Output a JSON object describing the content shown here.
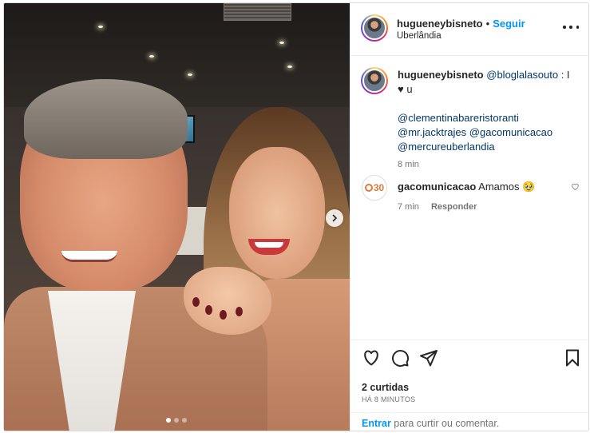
{
  "post": {
    "author": {
      "username": "hugueneybisneto",
      "location": "Uberlândia"
    },
    "follow_label": "Seguir",
    "separator": "•"
  },
  "caption": {
    "username": "hugueneybisneto",
    "mention_1": "@bloglalasouto",
    "text_1": " : I",
    "text_2": "♥ u",
    "mentions": [
      "@clementinabareristoranti",
      "@mr.jacktrajes",
      "@gacomunicacao",
      "@mercureuberlandia"
    ],
    "time": "8 min"
  },
  "comments": [
    {
      "username": "gacomunicacao",
      "avatar_text": "30",
      "text": "Amamos 🥹",
      "time": "7 min",
      "reply_label": "Responder"
    }
  ],
  "engagement": {
    "likes": "2 curtidas",
    "posted": "HÁ 8 MINUTOS"
  },
  "login_prompt": {
    "link": "Entrar",
    "text": " para curtir ou comentar."
  },
  "carousel": {
    "current": 1,
    "total": 3
  },
  "colors": {
    "accent": "#0095f6",
    "link": "#00376b",
    "muted": "#737373"
  },
  "icons": [
    "heart-icon",
    "comment-icon",
    "share-icon",
    "bookmark-icon",
    "more-icon",
    "chevron-right-icon"
  ]
}
